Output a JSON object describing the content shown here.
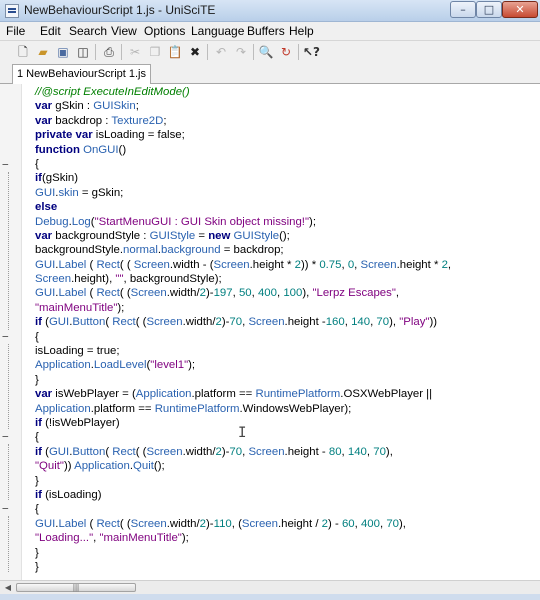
{
  "window": {
    "title": "NewBehaviourScript 1.js - UniSciTE"
  },
  "window_buttons": {
    "minimize": "–",
    "maximize": "□",
    "close": "✕"
  },
  "menu": [
    "File",
    "Edit",
    "Search",
    "View",
    "Options",
    "Language",
    "Buffers",
    "Help"
  ],
  "toolbar": {
    "icons": [
      "new-file-icon",
      "open-folder-icon",
      "save-icon",
      "save-as-icon",
      "print-icon",
      "cut-icon",
      "copy-icon",
      "paste-icon",
      "delete-icon",
      "undo-icon",
      "redo-icon",
      "find-icon",
      "replace-icon",
      "help-icon"
    ]
  },
  "tab": {
    "label": "1 NewBehaviourScript 1.js"
  },
  "fold_markers": {
    "collapse": "−"
  },
  "scrollbar": {
    "left_arrow": "◀",
    "thumb_grip": "|||"
  },
  "code_lines": [
    "//@script ExecuteInEditMode()",
    "var gSkin : GUISkin;",
    "var backdrop : Texture2D;",
    "private var isLoading = false;",
    "function OnGUI()",
    "{",
    "if(gSkin)",
    "GUI.skin = gSkin;",
    "else",
    "Debug.Log(\"StartMenuGUI : GUI Skin object missing!\");",
    "var backgroundStyle : GUIStyle = new GUIStyle();",
    "backgroundStyle.normal.background = backdrop;",
    "GUI.Label ( Rect( ( Screen.width - (Screen.height * 2)) * 0.75, 0, Screen.height * 2,",
    "Screen.height), \"\", backgroundStyle);",
    "GUI.Label ( Rect( (Screen.width/2)-197, 50, 400, 100), \"Lerpz Escapes\",",
    "\"mainMenuTitle\");",
    "if (GUI.Button( Rect( (Screen.width/2)-70, Screen.height -160, 140, 70), \"Play\"))",
    "{",
    "isLoading = true;",
    "Application.LoadLevel(\"level1\");",
    "}",
    "var isWebPlayer = (Application.platform == RuntimePlatform.OSXWebPlayer ||",
    "Application.platform == RuntimePlatform.WindowsWebPlayer);",
    "if (!isWebPlayer)",
    "{",
    "if (GUI.Button( Rect( (Screen.width/2)-70, Screen.height - 80, 140, 70),",
    "\"Quit\")) Application.Quit();",
    "}",
    "if (isLoading)",
    "{",
    "GUI.Label ( Rect( (Screen.width/2)-110, (Screen.height / 2) - 60, 400, 70),",
    "\"Loading...\", \"mainMenuTitle\");",
    "}",
    "}"
  ],
  "syntax_colors": {
    "keyword": "#00007f",
    "type": "#2a62b0",
    "string": "#7f007f",
    "number": "#007f7f",
    "comment": "#007f00"
  }
}
